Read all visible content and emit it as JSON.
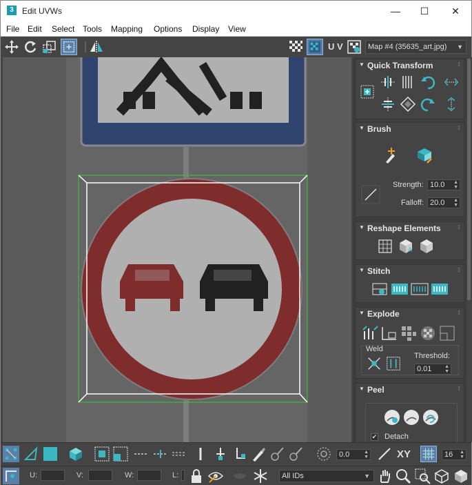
{
  "window": {
    "app_badge": "3",
    "title": "Edit UVWs",
    "minimize_label": "—",
    "maximize_label": "☐",
    "close_label": "✕"
  },
  "menu": [
    "File",
    "Edit",
    "Select",
    "Tools",
    "Mapping",
    "Options",
    "Display",
    "View"
  ],
  "toolbar": {
    "uv_label": "U V",
    "map_select": "Map #4 (35635_art.jpg)"
  },
  "panel": {
    "quick_transform": "Quick Transform",
    "brush": "Brush",
    "strength_label": "Strength:",
    "strength_value": "10.0",
    "falloff_label": "Falloff:",
    "falloff_value": "20.0",
    "reshape_elements": "Reshape Elements",
    "stitch": "Stitch",
    "explode": "Explode",
    "weld_label": "Weld",
    "threshold_label": "Threshold:",
    "threshold_value": "0.01",
    "peel": "Peel",
    "detach_label": "Detach",
    "detach_checked": "✔"
  },
  "bottom": {
    "angle_value": "0.0",
    "xy_label": "XY",
    "grid_value": "16",
    "u_label": "U:",
    "v_label": "V:",
    "w_label": "W:",
    "l_label": "L:",
    "ids_select": "All IDs"
  },
  "colors": {
    "accent_teal": "#3bb8c4",
    "sign_red": "#8e1f1f",
    "sign_blue": "#23407a",
    "selection_green": "#33cc33"
  }
}
